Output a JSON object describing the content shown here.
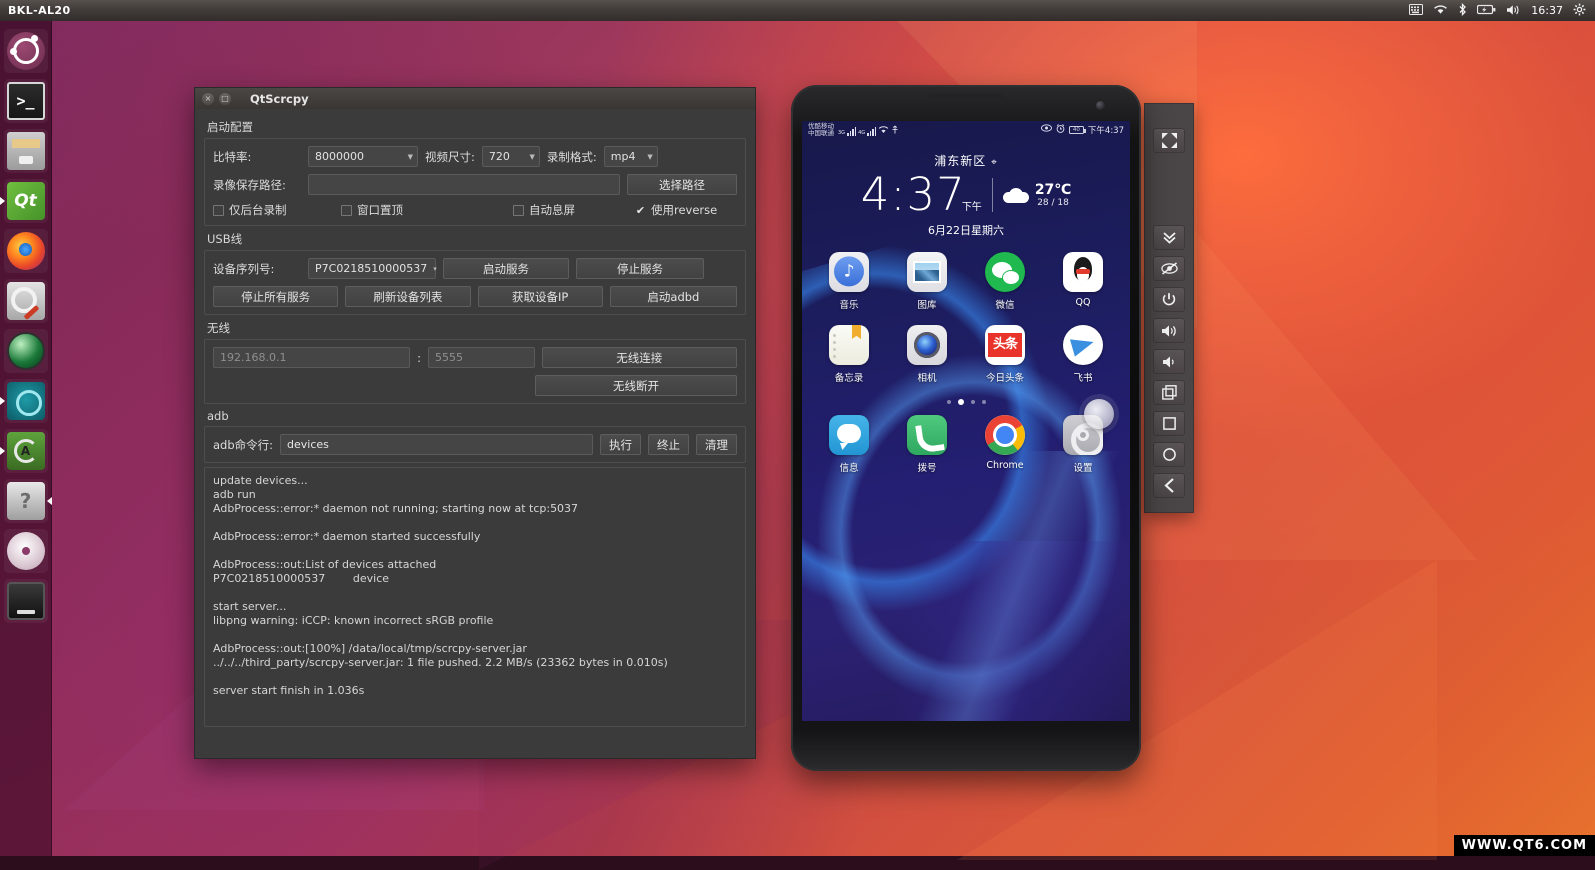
{
  "desktop": {
    "top_panel": {
      "window_title": "BKL-AL20",
      "clock": "16:37",
      "tray_icons": [
        "keyboard-icon",
        "wifi-icon",
        "bluetooth-icon",
        "battery-icon",
        "volume-icon",
        "gear-icon"
      ]
    },
    "launcher_items": [
      {
        "name": "ubuntu-dash",
        "icon": "ubuntu-logo-icon",
        "running": false,
        "focused": false
      },
      {
        "name": "terminal",
        "icon": "terminal-icon",
        "running": false,
        "focused": false
      },
      {
        "name": "files",
        "icon": "file-manager-icon",
        "running": false,
        "focused": false
      },
      {
        "name": "qt-creator",
        "icon": "qt-icon",
        "running": true,
        "focused": false
      },
      {
        "name": "firefox",
        "icon": "firefox-icon",
        "running": false,
        "focused": false
      },
      {
        "name": "system-tools",
        "icon": "tools-icon",
        "running": false,
        "focused": false
      },
      {
        "name": "globe-app",
        "icon": "globe-icon",
        "running": false,
        "focused": false
      },
      {
        "name": "android-tool",
        "icon": "cyan-circle-icon",
        "running": true,
        "focused": false
      },
      {
        "name": "software-updater",
        "icon": "update-icon",
        "running": true,
        "focused": false
      },
      {
        "name": "help",
        "icon": "question-mark-icon",
        "running": false,
        "focused": true
      },
      {
        "name": "disc",
        "icon": "disc-icon",
        "running": false,
        "focused": false
      },
      {
        "name": "phone-device",
        "icon": "phone-icon",
        "running": false,
        "focused": false
      }
    ],
    "watermark": "WWW.QT6.COM"
  },
  "qtscrcpy": {
    "title": "QtScrcpy",
    "titlebar_buttons": {
      "close": "×",
      "maximize": "□"
    },
    "start_config": {
      "group_label": "启动配置",
      "bitrate_label": "比特率:",
      "bitrate_value": "8000000",
      "video_size_label": "视频尺寸:",
      "video_size_value": "720",
      "record_format_label": "录制格式:",
      "record_format_value": "mp4",
      "save_path_label": "录像保存路径:",
      "save_path_value": "",
      "choose_path_button": "选择路径",
      "checkbox_bg_record": "仅后台录制",
      "checkbox_always_top": "窗口置顶",
      "checkbox_auto_off": "自动息屏",
      "checkbox_use_reverse": "使用reverse",
      "use_reverse_checked": true
    },
    "usb": {
      "group_label": "USB线",
      "serial_label": "设备序列号:",
      "serial_value": "P7C0218510000537",
      "start_service_button": "启动服务",
      "stop_service_button": "停止服务",
      "stop_all_services_button": "停止所有服务",
      "refresh_devices_button": "刷新设备列表",
      "get_device_ip_button": "获取设备IP",
      "start_adbd_button": "启动adbd"
    },
    "wireless": {
      "group_label": "无线",
      "ip_placeholder": "192.168.0.1",
      "separator": ":",
      "port_placeholder": "5555",
      "connect_button": "无线连接",
      "disconnect_button": "无线断开"
    },
    "adb": {
      "group_label": "adb",
      "cmd_label": "adb命令行:",
      "cmd_value": "devices",
      "run_button": "执行",
      "stop_button": "终止",
      "clear_button": "清理"
    },
    "log": "update devices...\nadb run\nAdbProcess::error:* daemon not running; starting now at tcp:5037\n\nAdbProcess::error:* daemon started successfully\n\nAdbProcess::out:List of devices attached\nP7C0218510000537\tdevice\n\nstart server...\nlibpng warning: iCCP: known incorrect sRGB profile\n\nAdbProcess::out:[100%] /data/local/tmp/scrcpy-server.jar\n../../../third_party/scrcpy-server.jar: 1 file pushed. 2.2 MB/s (23362 bytes in 0.010s)\n\nserver start finish in 1.036s"
  },
  "phone": {
    "status_bar": {
      "carrier_line1": "优酷移动",
      "carrier_line2": "中国联通",
      "net1": "3G",
      "net2": "4G",
      "battery_text": "40",
      "time": "下午4:37"
    },
    "lockscreen": {
      "location": "浦东新区",
      "location_pin": "⌖",
      "time": "4:37",
      "ampm": "下午",
      "temperature": "27℃",
      "temp_range": "28 / 18",
      "date": "6月22日星期六"
    },
    "apps_row1": [
      {
        "label": "音乐",
        "icon": "music-app-icon"
      },
      {
        "label": "图库",
        "icon": "gallery-app-icon"
      },
      {
        "label": "微信",
        "icon": "wechat-app-icon"
      },
      {
        "label": "QQ",
        "icon": "qq-app-icon"
      }
    ],
    "apps_row2": [
      {
        "label": "备忘录",
        "icon": "notes-app-icon"
      },
      {
        "label": "相机",
        "icon": "camera-app-icon"
      },
      {
        "label": "今日头条",
        "icon": "toutiao-app-icon"
      },
      {
        "label": "飞书",
        "icon": "feishu-app-icon"
      }
    ],
    "apps_dock": [
      {
        "label": "信息",
        "icon": "messages-app-icon"
      },
      {
        "label": "拨号",
        "icon": "dialer-app-icon"
      },
      {
        "label": "Chrome",
        "icon": "chrome-app-icon"
      },
      {
        "label": "设置",
        "icon": "settings-app-icon"
      }
    ],
    "page_dots": {
      "count": 4,
      "active_index": 1
    }
  },
  "side_toolbar": {
    "buttons": [
      {
        "name": "fullscreen-button",
        "icon": "expand-arrows-icon"
      },
      {
        "name": "expand-notification-button",
        "icon": "chevron-double-down-icon"
      },
      {
        "name": "screen-off-button",
        "icon": "eye-off-icon"
      },
      {
        "name": "power-button",
        "icon": "power-icon"
      },
      {
        "name": "volume-up-button",
        "icon": "volume-up-icon"
      },
      {
        "name": "volume-down-button",
        "icon": "volume-down-icon"
      },
      {
        "name": "app-switch-button",
        "icon": "copy-squares-icon"
      },
      {
        "name": "stop-button",
        "icon": "square-icon"
      },
      {
        "name": "home-button",
        "icon": "circle-icon"
      },
      {
        "name": "back-button",
        "icon": "chevron-left-icon"
      }
    ]
  }
}
